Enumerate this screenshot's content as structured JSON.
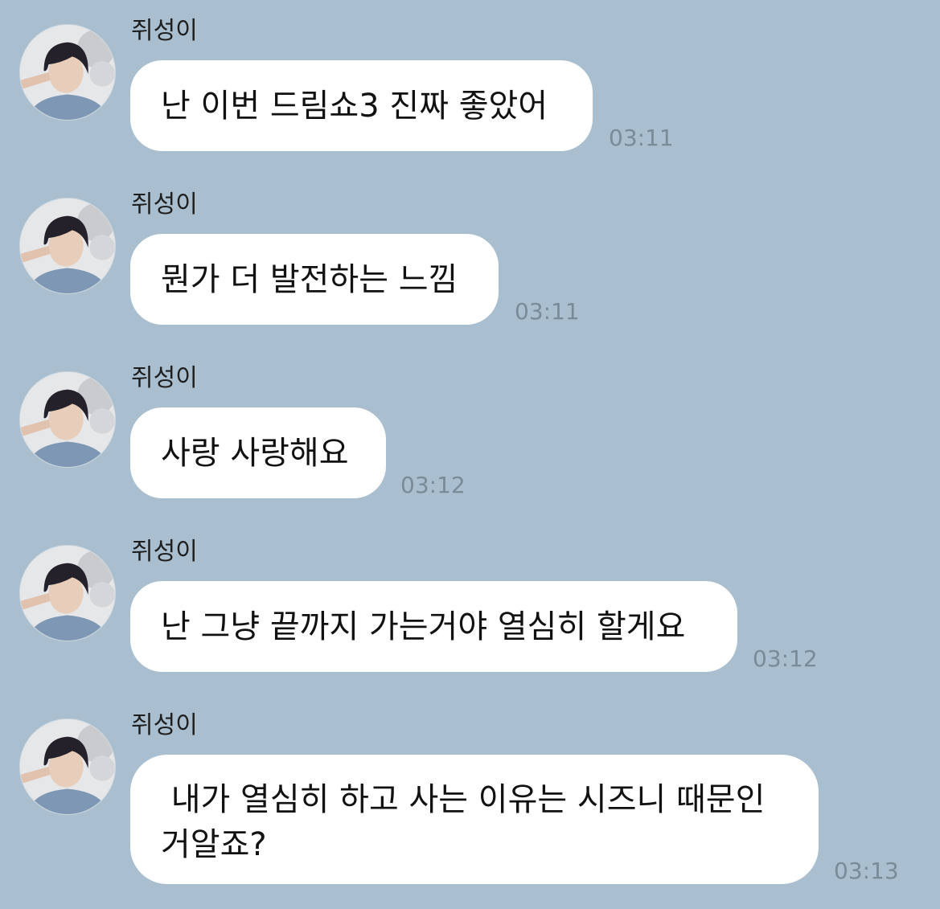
{
  "chat": {
    "messages": [
      {
        "sender": "쥐성이",
        "text": "난 이번 드림쇼3 진짜 좋았어",
        "time": "03:11"
      },
      {
        "sender": "쥐성이",
        "text": "뭔가 더 발전하는 느낌",
        "time": "03:11"
      },
      {
        "sender": "쥐성이",
        "text": "사랑 사랑해요",
        "time": "03:12"
      },
      {
        "sender": "쥐성이",
        "text": "난 그냥 끝까지 가는거야 열심히 할게요",
        "time": "03:12"
      },
      {
        "sender": "쥐성이",
        "text": " 내가 열심히 하고 사는 이유는 시즈니 때문인\n거알죠?",
        "time": "03:13"
      }
    ]
  },
  "colors": {
    "background": "#a9bfd0",
    "bubble": "#ffffff",
    "timestamp": "#7a8b98",
    "text": "#111111"
  },
  "icons": {
    "avatar": "profile-photo"
  }
}
